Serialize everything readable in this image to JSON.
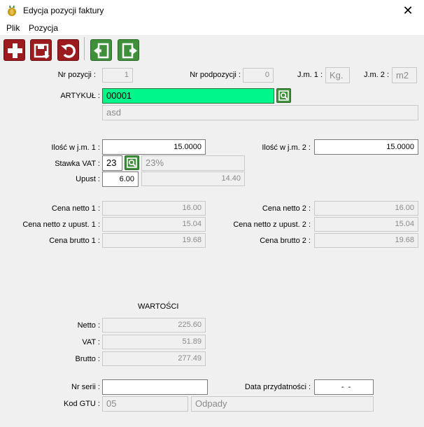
{
  "window": {
    "title": "Edycja pozycji faktury",
    "close": "✕"
  },
  "menu": [
    "Plik",
    "Pozycja"
  ],
  "toolbar": {
    "icons": [
      "add-icon",
      "save-icon",
      "undo-icon",
      "previous-icon",
      "next-icon"
    ],
    "colors": {
      "red": "#9b1b1f",
      "green": "#3f8f3b"
    }
  },
  "header": {
    "nr_pozycji_label": "Nr pozycji :",
    "nr_pozycji": "1",
    "nr_podpozycji_label": "Nr podpozycji :",
    "nr_podpozycji": "0",
    "jm1_label": "J.m. 1 :",
    "jm1": "Kg.",
    "jm2_label": "J.m. 2 :",
    "jm2": "m2"
  },
  "artykul": {
    "label": "ARTYKUŁ :",
    "code": "00001",
    "name": "asd",
    "highlight": "#00f58a"
  },
  "quantities": {
    "ilosc1_label": "Ilość w j.m. 1 :",
    "ilosc1": "15.0000",
    "ilosc2_label": "Ilość w j.m. 2 :",
    "ilosc2": "15.0000",
    "vat_label": "Stawka VAT :",
    "vat_code": "23",
    "vat_desc": "23%",
    "upust_label": "Upust :",
    "upust": "6.00",
    "upust_amount": "14.40"
  },
  "prices": {
    "netto1_label": "Cena netto 1 :",
    "netto1": "16.00",
    "netto2_label": "Cena netto 2 :",
    "netto2": "16.00",
    "netto_upust1_label": "Cena netto z upust. 1 :",
    "netto_upust1": "15.04",
    "netto_upust2_label": "Cena netto z upust. 2 :",
    "netto_upust2": "15.04",
    "brutto1_label": "Cena brutto 1 :",
    "brutto1": "19.68",
    "brutto2_label": "Cena brutto 2 :",
    "brutto2": "19.68"
  },
  "wartosci": {
    "heading": "WARTOŚCI",
    "netto_label": "Netto :",
    "netto": "225.60",
    "vat_label": "VAT :",
    "vat": "51.89",
    "brutto_label": "Brutto :",
    "brutto": "277.49"
  },
  "footer": {
    "nr_serii_label": "Nr serii :",
    "nr_serii": "",
    "data_label": "Data przydatności :",
    "data": "  -  -",
    "gtu_label": "Kod GTU :",
    "gtu_code": "05",
    "gtu_desc": "Odpady"
  }
}
